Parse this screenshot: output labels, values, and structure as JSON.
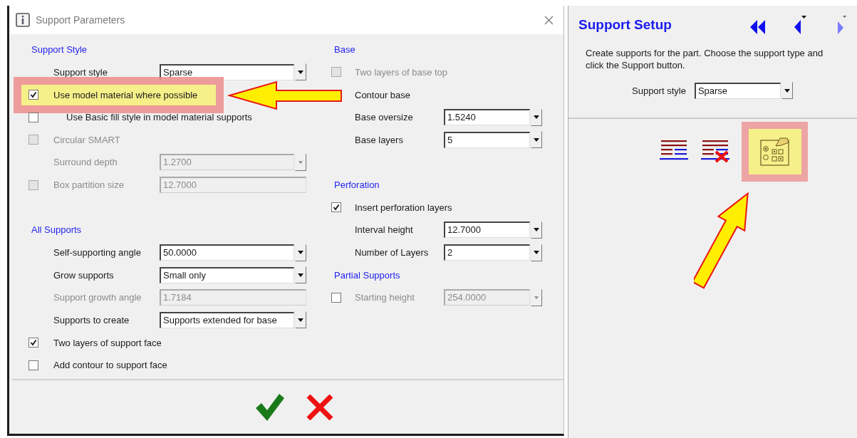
{
  "dialog": {
    "title": "Support Parameters",
    "columns": [
      {
        "rows": [
          {
            "kind": "heading",
            "text": "Support Style"
          },
          {
            "kind": "option",
            "label": "Support style",
            "disabled": false,
            "field": {
              "value": "Sparse",
              "dropdown": true
            }
          },
          {
            "kind": "option",
            "label": "Use model material where possible",
            "disabled": false,
            "highlighted": true,
            "pointer": true,
            "check": {
              "checked": true,
              "disabled": false
            }
          },
          {
            "kind": "option",
            "label": "Use Basic fill style in model material supports",
            "disabled": false,
            "indent": true,
            "check": {
              "checked": false,
              "disabled": false
            }
          },
          {
            "kind": "option",
            "label": "Circular SMART",
            "disabled": true,
            "check": {
              "checked": false,
              "disabled": true
            }
          },
          {
            "kind": "option",
            "label": "Surround depth",
            "disabled": true,
            "field": {
              "value": "1.2700",
              "dropdown": true
            }
          },
          {
            "kind": "option",
            "label": "Box partition size",
            "disabled": true,
            "check": {
              "checked": false,
              "disabled": true
            },
            "field": {
              "value": "12.7000",
              "dropdown": false
            }
          },
          {
            "kind": "spacer"
          },
          {
            "kind": "heading",
            "text": "All Supports"
          },
          {
            "kind": "option",
            "label": "Self-supporting angle",
            "disabled": false,
            "field": {
              "value": "50.0000",
              "dropdown": true
            }
          },
          {
            "kind": "option",
            "label": "Grow supports",
            "disabled": false,
            "field": {
              "value": "Small only",
              "dropdown": true
            }
          },
          {
            "kind": "option",
            "label": "Support growth angle",
            "disabled": true,
            "field": {
              "value": "1.7184",
              "dropdown": false
            }
          },
          {
            "kind": "option",
            "label": "Supports to create",
            "disabled": false,
            "field": {
              "value": "Supports extended for base",
              "dropdown": true
            }
          },
          {
            "kind": "option",
            "label": "Two layers of support face",
            "disabled": false,
            "check": {
              "checked": true,
              "disabled": false
            }
          },
          {
            "kind": "option",
            "label": "Add contour to support face",
            "disabled": false,
            "check": {
              "checked": false,
              "disabled": false
            }
          }
        ]
      },
      {
        "rows": [
          {
            "kind": "heading",
            "text": "Base"
          },
          {
            "kind": "option",
            "label": "Two layers of base top",
            "disabled": true,
            "check": {
              "checked": false,
              "disabled": true
            }
          },
          {
            "kind": "option",
            "label": "Contour base",
            "disabled": false
          },
          {
            "kind": "option",
            "label": "Base oversize",
            "disabled": false,
            "field": {
              "value": "1.5240",
              "dropdown": true
            }
          },
          {
            "kind": "option",
            "label": "Base layers",
            "disabled": false,
            "field": {
              "value": "5",
              "dropdown": true
            }
          },
          {
            "kind": "spacer"
          },
          {
            "kind": "heading",
            "text": "Perforation"
          },
          {
            "kind": "option",
            "label": "Insert perforation layers",
            "disabled": false,
            "check": {
              "checked": true,
              "disabled": false
            }
          },
          {
            "kind": "option",
            "label": "Interval height",
            "disabled": false,
            "field": {
              "value": "12.7000",
              "dropdown": true
            }
          },
          {
            "kind": "option",
            "label": "Number of Layers",
            "disabled": false,
            "field": {
              "value": "2",
              "dropdown": true
            }
          },
          {
            "kind": "heading",
            "text": "Partial Supports"
          },
          {
            "kind": "option",
            "label": "Starting height",
            "disabled": true,
            "check": {
              "checked": false,
              "disabled": false
            },
            "field": {
              "value": "254.0000",
              "dropdown": true
            }
          }
        ]
      }
    ],
    "buttons": [
      {
        "kind": "ok"
      },
      {
        "kind": "cancel"
      }
    ]
  },
  "panel": {
    "title": "Support Setup",
    "nav": [
      {
        "kind": "first"
      },
      {
        "kind": "previous"
      },
      {
        "kind": "next"
      }
    ],
    "description": "Create supports for the part. Choose the support type and click the Support button.",
    "style_field": {
      "label": "Support style",
      "value": "Sparse"
    },
    "tools": [
      {
        "kind": "generate",
        "highlighted": false
      },
      {
        "kind": "delete",
        "highlighted": false
      },
      {
        "kind": "options",
        "highlighted": true,
        "pointer": true
      }
    ]
  }
}
